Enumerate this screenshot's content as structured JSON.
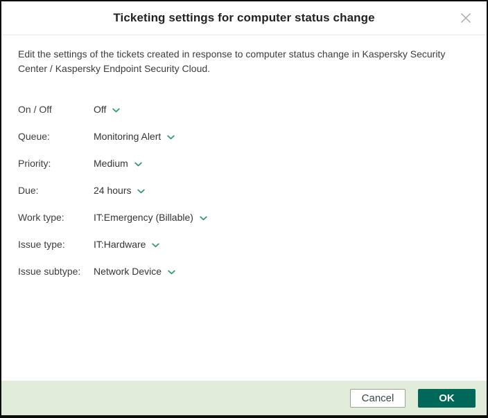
{
  "dialog": {
    "title": "Ticketing settings for computer status change",
    "description_line1": "Edit the settings of the tickets created in response to computer status change in Kaspersky Security",
    "description_line2": "Center / Kaspersky Endpoint Security Cloud.",
    "fields": [
      {
        "label": "On / Off",
        "value": "Off"
      },
      {
        "label": "Queue:",
        "value": "Monitoring Alert"
      },
      {
        "label": "Priority:",
        "value": "Medium"
      },
      {
        "label": "Due:",
        "value": "24 hours"
      },
      {
        "label": "Work type:",
        "value": "IT:Emergency (Billable)"
      },
      {
        "label": "Issue type:",
        "value": "IT:Hardware"
      },
      {
        "label": "Issue subtype:",
        "value": "Network Device"
      }
    ],
    "footer": {
      "cancel_label": "Cancel",
      "ok_label": "OK"
    },
    "icons": {
      "close": "close-icon",
      "dropdown": "chevron-down-icon"
    },
    "colors": {
      "accent_green": "#2f957c",
      "ok_button": "#006858",
      "footer_bg": "#e2ecda"
    }
  }
}
